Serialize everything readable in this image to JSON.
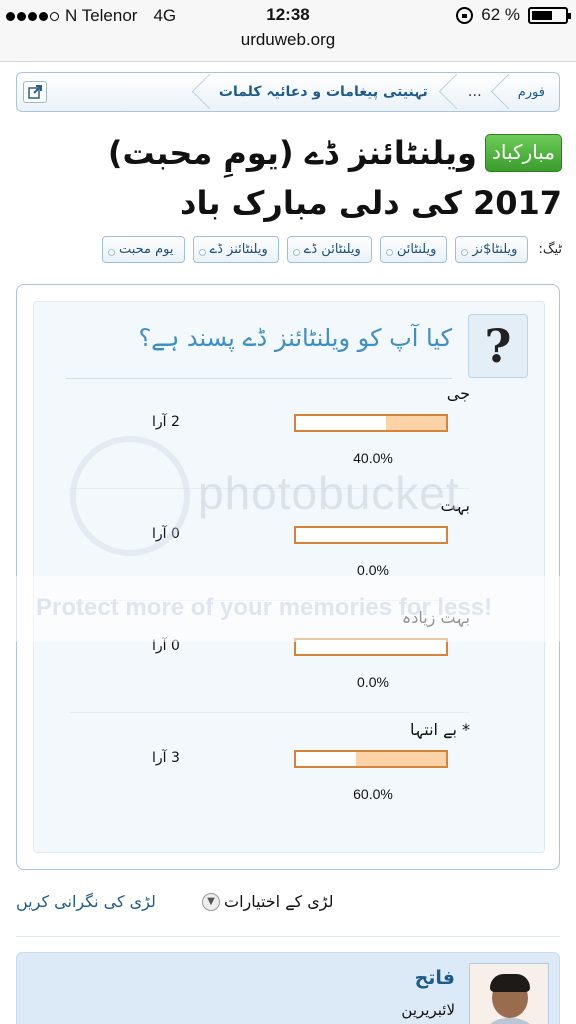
{
  "status_bar": {
    "carrier": "N Telenor",
    "network": "4G",
    "time": "12:38",
    "battery": "62 %",
    "battery_level": 0.62
  },
  "browser": {
    "url": "urduweb.org"
  },
  "breadcrumb": {
    "items": [
      "فورم",
      "…",
      "تہنیتی پیغامات و دعائیہ کلمات"
    ]
  },
  "thread": {
    "prefix": "مبارکباد",
    "title": "ویلنٹائنز ڈے (یومِ محبت) 2017 کی دلی مبارک باد"
  },
  "tags": {
    "label": "ٹیگ:",
    "items": [
      "ویلنٹا$نز",
      "ویلنٹائن",
      "ویلنٹائن ڈے",
      "ویلنٹائنز ڈے",
      "یوم محبت"
    ]
  },
  "poll": {
    "question_icon": "?",
    "question": "کیا آپ کو ویلنٹائنز ڈے پسند ہے؟",
    "options": [
      {
        "name": "جی",
        "votes": "2 آرا",
        "percent": "40.0%",
        "fraction": 0.4
      },
      {
        "name": "بہت",
        "votes": "0 آرا",
        "percent": "0.0%",
        "fraction": 0.0
      },
      {
        "name": "بہت زیادہ",
        "votes": "0 آرا",
        "percent": "0.0%",
        "fraction": 0.0
      },
      {
        "name": "* بے انتہا",
        "votes": "3 آرا",
        "percent": "60.0%",
        "fraction": 0.6
      }
    ]
  },
  "watermark": {
    "brand": "photobucket",
    "banner": "Protect more of your memories for less!"
  },
  "thread_tools": {
    "options_label": "لڑی کے اختیارات",
    "watch_label": "لڑی کی نگرانی کریں"
  },
  "post": {
    "username": "فاتح",
    "user_title": "لائبریرین"
  },
  "icons": {
    "jump": "external-link-icon",
    "options": "chevron-down-icon",
    "question": "question-mark-icon"
  }
}
